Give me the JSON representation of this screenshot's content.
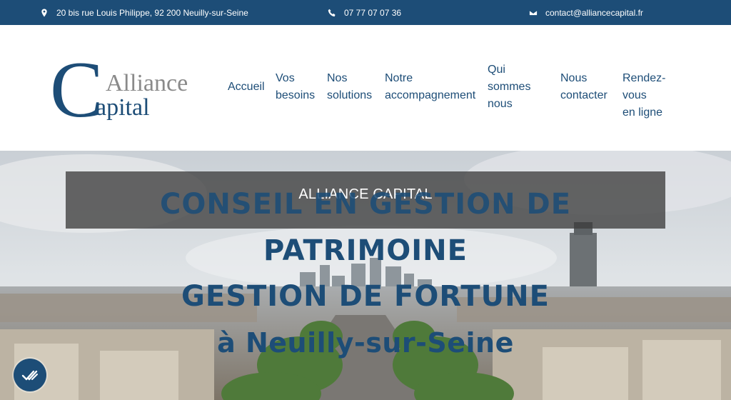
{
  "topbar": {
    "address": "20 bis rue Louis Philippe, 92 200 Neuilly-sur-Seine",
    "phone": "07 77 07 07 36",
    "email": "contact@alliancecapital.fr",
    "icons": [
      "map-pin-icon",
      "phone-icon",
      "mail-icon"
    ]
  },
  "logo": {
    "word1": "Alliance",
    "word2": "apital",
    "letter": "C"
  },
  "nav": {
    "items": [
      {
        "label": "Accueil"
      },
      {
        "label": "Vos\nbesoins"
      },
      {
        "label": "Nos\nsolutions"
      },
      {
        "label": "Notre\naccompagnement"
      },
      {
        "label": "Qui\nsommes\nnous"
      },
      {
        "label": "Nous\ncontacter"
      },
      {
        "label": "Rendez-vous\nen ligne"
      }
    ]
  },
  "hero": {
    "banner_title": "ALLIANCE CAPITAL",
    "line1": "CONSEIL EN GESTION DE",
    "line2": "PATRIMOINE",
    "line3": "GESTION DE FORTUNE",
    "line4": "à Neuilly-sur-Seine"
  },
  "colors": {
    "brand": "#1d4d77",
    "topbar_bg": "#1d4d77",
    "banner_bg": "#3e3e3e"
  }
}
